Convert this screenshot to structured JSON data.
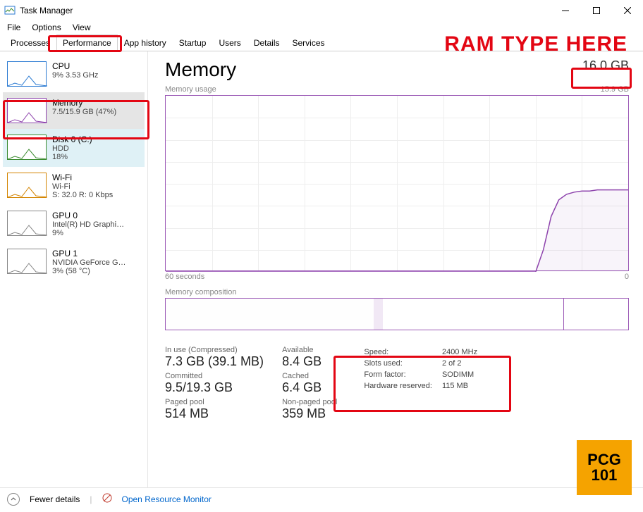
{
  "window": {
    "title": "Task Manager"
  },
  "menu": [
    "File",
    "Options",
    "View"
  ],
  "tabs": [
    "Processes",
    "Performance",
    "App history",
    "Startup",
    "Users",
    "Details",
    "Services"
  ],
  "active_tab_index": 1,
  "sidebar": [
    {
      "title": "CPU",
      "sub": "9%  3.53 GHz",
      "sub2": "",
      "color": "#2a7ad2",
      "selected": false
    },
    {
      "title": "Memory",
      "sub": "7.5/15.9 GB (47%)",
      "sub2": "",
      "color": "#8e44ad",
      "selected": true
    },
    {
      "title": "Disk 0 (C:)",
      "sub": "HDD",
      "sub2": "18%",
      "color": "#3a8a2e",
      "selected": false,
      "bg": "#dff1f6"
    },
    {
      "title": "Wi-Fi",
      "sub": "Wi-Fi",
      "sub2": "S: 32.0  R: 0 Kbps",
      "color": "#d38400",
      "selected": false
    },
    {
      "title": "GPU 0",
      "sub": "Intel(R) HD Graphi…",
      "sub2": "9%",
      "color": "#888",
      "selected": false
    },
    {
      "title": "GPU 1",
      "sub": "NVIDIA GeForce G…",
      "sub2": "3%  (58 °C)",
      "color": "#888",
      "selected": false
    }
  ],
  "main": {
    "title": "Memory",
    "total": "16.0 GB",
    "chart_top_label_left": "Memory usage",
    "chart_top_label_right": "15.9 GB",
    "chart_bottom_left": "60 seconds",
    "chart_bottom_right": "0",
    "composition_label": "Memory composition",
    "composition_segments": [
      {
        "width_pct": 45,
        "fill": "#8e44ad",
        "opacity": 0.08
      },
      {
        "width_pct": 2,
        "fill": "#8e44ad",
        "opacity": 0.35
      },
      {
        "width_pct": 39,
        "fill": "#ffffff",
        "opacity": 1
      },
      {
        "width_pct": 14,
        "fill": "#ffffff",
        "opacity": 1,
        "border_left": true
      }
    ],
    "details_left": [
      {
        "label": "In use (Compressed)",
        "value": "7.3 GB (39.1 MB)"
      },
      {
        "label": "Available",
        "value": "8.4 GB"
      },
      {
        "label": "Committed",
        "value": "9.5/19.3 GB"
      },
      {
        "label": "Cached",
        "value": "6.4 GB"
      },
      {
        "label": "Paged pool",
        "value": "514 MB"
      },
      {
        "label": "Non-paged pool",
        "value": "359 MB"
      }
    ],
    "details_right": [
      {
        "label": "Speed:",
        "value": "2400 MHz"
      },
      {
        "label": "Slots used:",
        "value": "2 of 2"
      },
      {
        "label": "Form factor:",
        "value": "SODIMM"
      },
      {
        "label": "Hardware reserved:",
        "value": "115 MB"
      }
    ]
  },
  "footer": {
    "fewer": "Fewer details",
    "resmon": "Open Resource Monitor"
  },
  "annotations": {
    "headline": "RAM TYPE HERE",
    "badge_top": "PCG",
    "badge_bottom": "101"
  },
  "chart_data": {
    "type": "line",
    "title": "Memory usage",
    "xlabel": "60 seconds → 0",
    "ylabel": "GB",
    "ylim": [
      0,
      15.9
    ],
    "x_seconds_ago": [
      60,
      55,
      50,
      45,
      40,
      35,
      30,
      25,
      20,
      15,
      12,
      11,
      10,
      9,
      8,
      7,
      6,
      5,
      4,
      3,
      2,
      1,
      0
    ],
    "values_gb": [
      0,
      0,
      0,
      0,
      0,
      0,
      0,
      0,
      0,
      0,
      0,
      2,
      5,
      6.5,
      7.0,
      7.2,
      7.3,
      7.3,
      7.4,
      7.4,
      7.4,
      7.4,
      7.4
    ]
  }
}
